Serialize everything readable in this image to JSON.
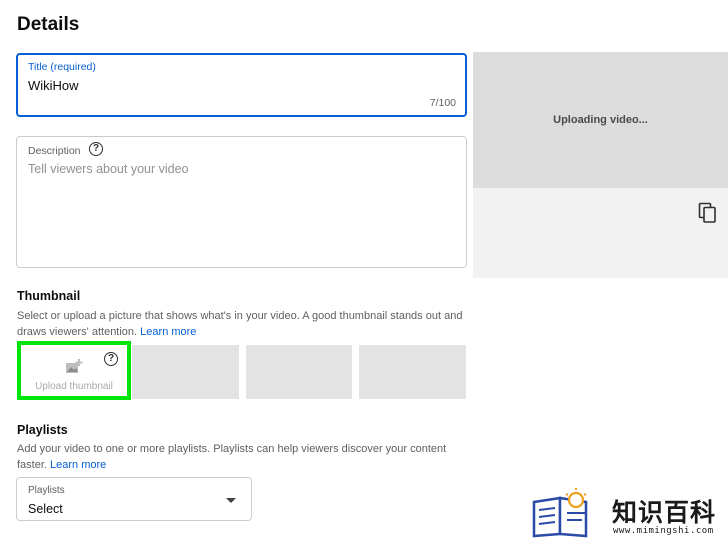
{
  "page": {
    "title": "Details"
  },
  "title_field": {
    "label": "Title (required)",
    "value": "WikiHow",
    "counter": "7/100"
  },
  "description_field": {
    "label": "Description",
    "placeholder": "Tell viewers about your video",
    "help": "?"
  },
  "preview": {
    "status": "Uploading video...",
    "copy_icon": "copy-icon"
  },
  "thumbnail": {
    "heading": "Thumbnail",
    "description": "Select or upload a picture that shows what's in your video. A good thumbnail stands out and draws viewers' attention.",
    "learn_more": "Learn more",
    "upload_label": "Upload thumbnail",
    "help": "?",
    "highlight_color": "#00e50a"
  },
  "playlists": {
    "heading": "Playlists",
    "description": "Add your video to one or more playlists. Playlists can help viewers discover your content faster.",
    "learn_more": "Learn more",
    "select_label": "Playlists",
    "select_value": "Select"
  },
  "watermark": {
    "text": "知识百科",
    "url": "www.mimingshi.com"
  },
  "colors": {
    "accent": "#065fd4",
    "text": "#0d0d0d",
    "muted": "#606060"
  }
}
